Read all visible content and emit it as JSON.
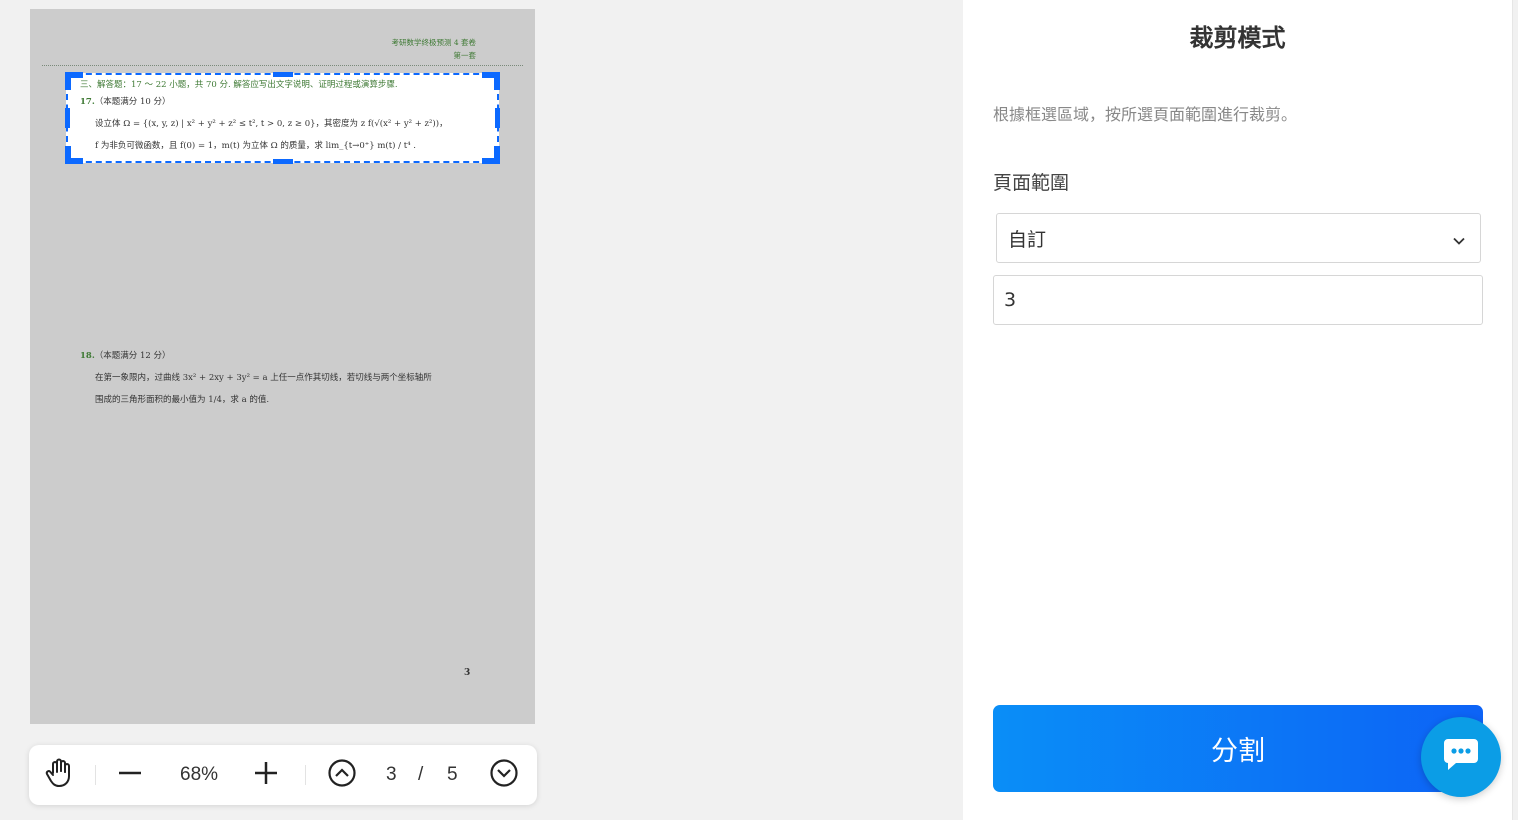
{
  "document": {
    "header_line1": "考研数学终极预测 4 套卷",
    "header_line2": "第一套",
    "section_title": "三、解答题：17 ～ 22 小题，共 70 分. 解答应写出文字说明、证明过程或演算步骤.",
    "problem17": {
      "number": "17.",
      "score": "（本题满分 10 分）",
      "line1": "设立体 Ω = {(x, y, z) | x² + y² + z² ≤ t², t > 0, z ≥ 0}，其密度为 z f(√(x² + y² + z²))，",
      "line2": "f 为非负可微函数，且 f(0) = 1，m(t) 为立体 Ω 的质量，求 lim_{t→0⁺} m(t) / t⁴ ."
    },
    "problem18": {
      "number": "18.",
      "score": "（本题满分 12 分）",
      "line1": "在第一象限内，过曲线 3x² + 2xy + 3y² = a 上任一点作其切线，若切线与两个坐标轴所",
      "line2": "围成的三角形面积的最小值为 1/4，求 a 的值."
    },
    "page_number": "3"
  },
  "toolbar": {
    "zoom": "68%",
    "current_page": "3",
    "separator": "/",
    "total_pages": "5",
    "icons": [
      "hand-icon",
      "zoom-out-icon",
      "zoom-in-icon",
      "page-up-icon",
      "page-down-icon"
    ]
  },
  "panel": {
    "title": "裁剪模式",
    "description": "根據框選區域，按所選頁面範圍進行裁剪。",
    "range_label": "頁面範圍",
    "range_selected": "自訂",
    "range_value": "3",
    "split_button": "分割"
  },
  "colors": {
    "accent": "#0c69ff",
    "button_gradient_start": "#0a8ef7",
    "button_gradient_end": "#0d63f6",
    "chat_button": "#0b9de6",
    "page_bg": "#cccccc"
  }
}
